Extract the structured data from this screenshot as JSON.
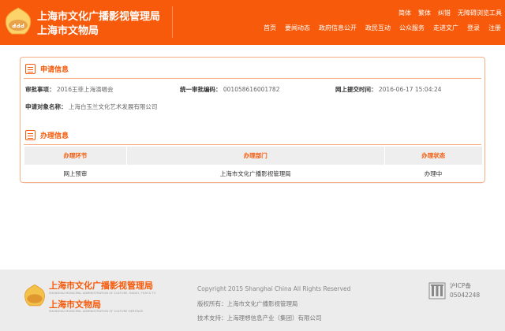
{
  "header": {
    "title_line1": "上海市文化广播影视管理局",
    "title_line2": "上海市文物局",
    "utility_links": [
      "简体",
      "繁体",
      "纠错",
      "无障碍浏览工具"
    ],
    "nav_items": [
      "首页",
      "要闻动态",
      "政府信息公开",
      "政民互动",
      "公众服务",
      "走进文广",
      "登录",
      "注册"
    ]
  },
  "application": {
    "section_title": "申请信息",
    "item_label": "审批事项：",
    "item_value": "2016王菲上海演唱会",
    "code_label": "统一审批编码：",
    "code_value": "001058616001782",
    "time_label": "网上提交时间：",
    "time_value": "2016-06-17 15:04:24",
    "applicant_label": "申请对象名称：",
    "applicant_value": "上海白玉兰文化艺术发展有限公司"
  },
  "processing": {
    "section_title": "办理信息",
    "columns": [
      "办理环节",
      "办理部门",
      "办理状态"
    ],
    "rows": [
      [
        "网上预审",
        "上海市文化广播影视管理局",
        "办理中"
      ]
    ]
  },
  "footer": {
    "title_line1": "上海市文化广播影视管理局",
    "subtitle_line1": "SHANGHAI MUNICIPAL ADMINISTRATION OF CULTURE, RADIO, FILM & TV",
    "title_line2": "上海市文物局",
    "subtitle_line2": "SHANGHAI MUNICIPAL ADMINISTRATION OF CULTURE HERITAGE",
    "copyright": "Copyright 2015 Shanghai China All Rights Reserved",
    "owner": "版权所有：上海市文化广播影视管理局",
    "support": "技术支持：上海理想信息产业（集团）有限公司",
    "icp_line1": "沪ICP备",
    "icp_line2": "05042248"
  },
  "colors": {
    "brand_orange": "#f65a0a",
    "panel_border": "#f8ae85",
    "footer_bg": "#ececec",
    "table_header_bg": "#eeeeee"
  }
}
